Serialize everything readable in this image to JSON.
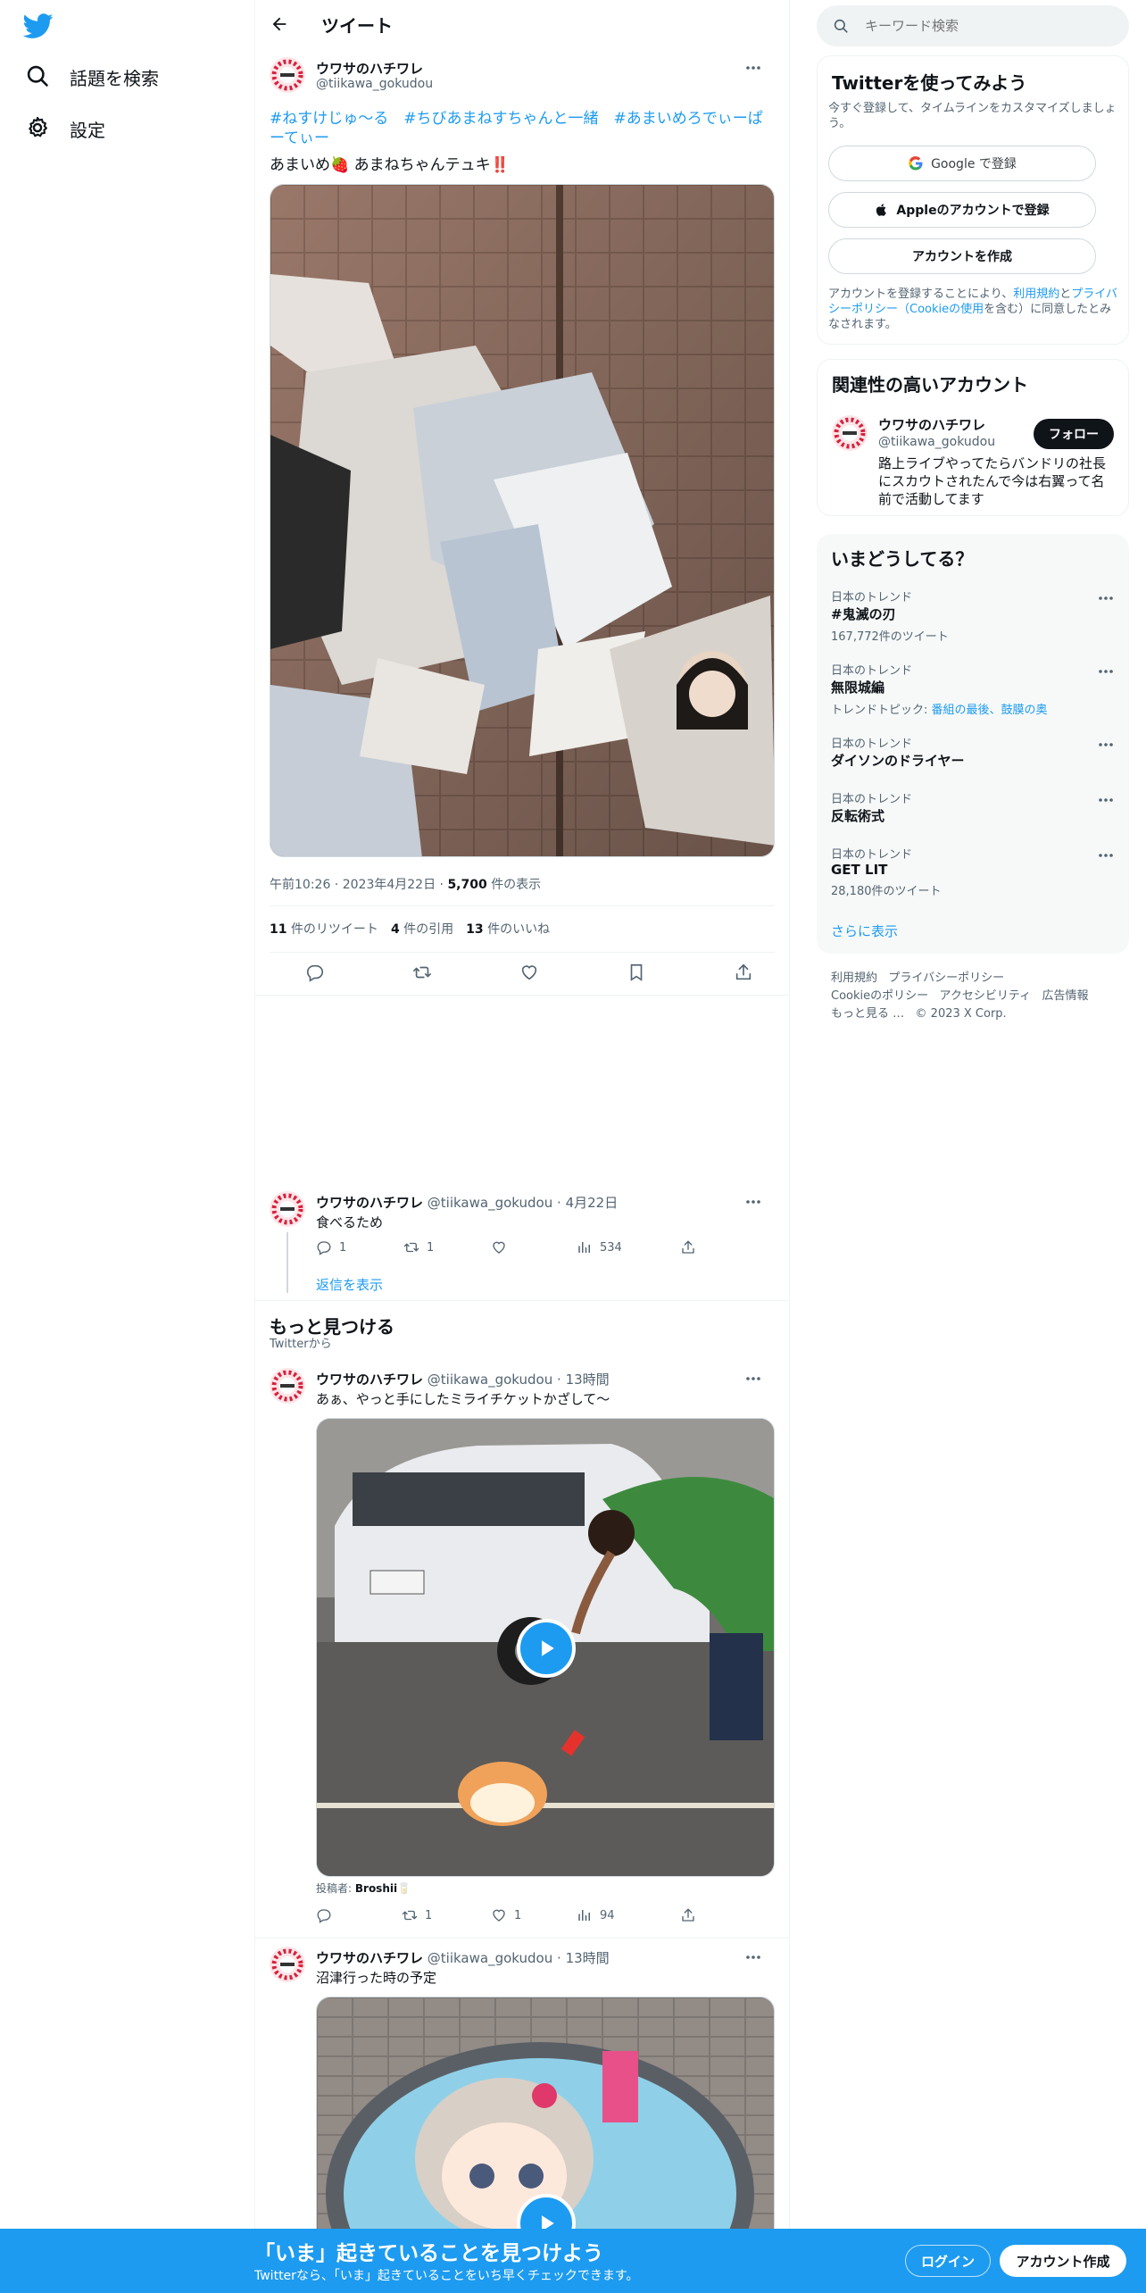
{
  "nav": {
    "explore_label": "話題を検索",
    "settings_label": "設定"
  },
  "header": {
    "title": "ツイート"
  },
  "tweet": {
    "author_name": "ウワサのハチワレ",
    "author_handle": "@tiikawa_gokudou",
    "hashtags_line1": "#ねすけじゅ〜る　#ちびあまねすちゃんと一緒　#あまいめろでぃーぱーてぃー",
    "body": "あまいめ🍓 あまねちゃんテュキ‼️",
    "time": "午前10:26",
    "date": "2023年4月22日",
    "views_count": "5,700",
    "views_label": "件の表示",
    "retweets_count": "11",
    "retweets_label": "件のリツイート",
    "quotes_count": "4",
    "quotes_label": "件の引用",
    "likes_count": "13",
    "likes_label": "件のいいね"
  },
  "reply": {
    "author_name": "ウワサのハチワレ",
    "author_handle": "@tiikawa_gokudou",
    "date": "4月22日",
    "body": "食べるため",
    "replies": "1",
    "retweets": "1",
    "views": "534",
    "show_replies": "返信を表示"
  },
  "discover": {
    "title": "もっと見つける",
    "subtitle": "Twitterから"
  },
  "discover_tweets": [
    {
      "author_name": "ウワサのハチワレ",
      "author_handle": "@tiikawa_gokudou",
      "time": "13時間",
      "body": "あぁ、やっと手にしたミライチケットかざして〜",
      "credit_label": "投稿者:",
      "credit_name": "Broshii🥛",
      "retweets": "1",
      "likes": "1",
      "views": "94"
    },
    {
      "author_name": "ウワサのハチワレ",
      "author_handle": "@tiikawa_gokudou",
      "time": "13時間",
      "body": "沼津行った時の予定"
    }
  ],
  "search": {
    "placeholder": "キーワード検索"
  },
  "signup": {
    "title": "Twitterを使ってみよう",
    "subtitle": "今すぐ登録して、タイムラインをカスタマイズしましょう。",
    "google": "Google で登録",
    "apple": "Appleのアカウントで登録",
    "create": "アカウントを作成",
    "terms_pre": "アカウントを登録することにより、",
    "terms_link": "利用規約",
    "terms_mid": "と",
    "privacy_link": "プライバシーポリシー",
    "cookie_link": "（Cookieの使用",
    "terms_post": "を含む）に同意したとみなされます。"
  },
  "related": {
    "title": "関連性の高いアカウント",
    "name": "ウワサのハチワレ",
    "handle": "@tiikawa_gokudou",
    "follow": "フォロー",
    "bio": "路上ライブやってたらバンドリの社長にスカウトされたんで今は右翼って名前で活動してます"
  },
  "trends": {
    "title": "いまどうしてる？",
    "items": [
      {
        "kicker": "日本のトレンド",
        "name": "#鬼滅の刃",
        "meta": "167,772件のツイート"
      },
      {
        "kicker": "日本のトレンド",
        "name": "無限城編",
        "meta_pre": "トレンドトピック: ",
        "meta_link": "番組の最後、鼓膜の奥"
      },
      {
        "kicker": "日本のトレンド",
        "name": "ダイソンのドライヤー"
      },
      {
        "kicker": "日本のトレンド",
        "name": "反転術式"
      },
      {
        "kicker": "日本のトレンド",
        "name": "GET LIT",
        "meta": "28,180件のツイート"
      }
    ],
    "show_more": "さらに表示"
  },
  "footer": {
    "terms": "利用規約",
    "privacy": "プライバシーポリシー",
    "cookie": "Cookieのポリシー",
    "accessibility": "アクセシビリティ",
    "ads": "広告情報",
    "more": "もっと見る …",
    "copyright": "© 2023 X Corp."
  },
  "bottombar": {
    "headline": "「いま」起きていることを見つけよう",
    "sub": "Twitterなら、「いま」起きていることをいち早くチェックできます。",
    "login": "ログイン",
    "signup": "アカウント作成"
  },
  "colors": {
    "accent": "#1d9bf0",
    "text": "#0f1419",
    "muted": "#536471"
  }
}
